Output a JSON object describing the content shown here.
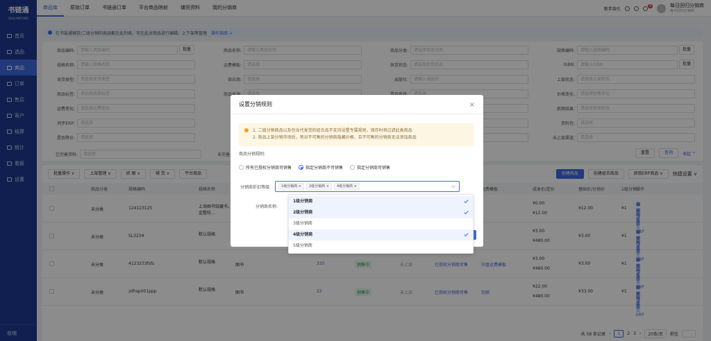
{
  "sidebar": {
    "logo": "书链通",
    "logo_sub": "SHULIANTONG",
    "items": [
      {
        "label": "首页"
      },
      {
        "label": "选品"
      },
      {
        "label": "商品"
      },
      {
        "label": "订单"
      },
      {
        "label": "售后"
      },
      {
        "label": "客户"
      },
      {
        "label": "结算"
      },
      {
        "label": "统计"
      },
      {
        "label": "看板"
      },
      {
        "label": "设置"
      }
    ],
    "bottom": "收缩"
  },
  "topbar": {
    "tabs": [
      "商品库",
      "原始订单",
      "书链通订单",
      "平台商品映射",
      "铺货资料",
      "我的分销商"
    ],
    "guide": "新手指引",
    "badge": "9",
    "user_name": "每日回归分销商",
    "user_sub": "每日回归分销商"
  },
  "notice": {
    "text": "在书链通铺货/二级分销的商品都在此列表，可在此对商品进行编辑、上下架等管理",
    "link": "操作指南 >"
  },
  "filters": {
    "rows": [
      [
        {
          "label": "商品编码:",
          "ph": "请输入商品编码",
          "btn": "批量"
        },
        {
          "label": "商品名称:",
          "ph": "请输入商品名称"
        },
        {
          "label": "商品分类:",
          "ph": "请选择商品分类"
        },
        {
          "label": "规格编码:",
          "ph": "请输入规格编码",
          "btn": "批量"
        }
      ],
      [
        {
          "label": "规格名称:",
          "ph": "请输入规格名称"
        },
        {
          "label": "运费模板:",
          "ph": "请选择"
        },
        {
          "label": "供货状态:",
          "ph": "请选择供货状态"
        },
        {
          "label": "ISBN:",
          "ph": "请输入ISBN",
          "btn": "批量"
        }
      ],
      [
        {
          "label": "发货类型:",
          "ph": "请选择发货类型"
        },
        {
          "label": "供应商:",
          "ph": "请选择"
        },
        {
          "label": "出版社:",
          "ph": "请输入出版社"
        },
        {
          "label": "上架状态:",
          "ph": "请选择上架状态"
        }
      ],
      [
        {
          "label": "商品标签:",
          "ph": "请选择商品标签"
        },
        {
          "label": "商品来源:",
          "ph": "请选择"
        },
        {
          "label": "是否有效:",
          "ph": "请选择"
        },
        {
          "label": "价格变化:",
          "ph": "请选择价格变化"
        }
      ],
      [
        {
          "label": "运费变化:",
          "ph": "请选择运费变化"
        },
        {
          "label": "更新:",
          "ph": "请选择"
        },
        {
          "label": "上架渠道:",
          "ph": "请选择"
        },
        {
          "label": "抓图结果:",
          "ph": "请选择抓图状态"
        }
      ],
      [
        {
          "label": "同步ERP:",
          "ph": "请选择"
        },
        {
          "label": "有无:",
          "ph": "请选择"
        },
        {
          "label": "库存:",
          "ph": "请选择"
        },
        {
          "label": "资料包:",
          "ph": "请选择"
        }
      ],
      [
        {
          "label": "是否降价:",
          "ph": "请选择"
        },
        {
          "label": "禁售:",
          "ph": "请选择"
        },
        {
          "label": "平台:",
          "ph": "请选择"
        },
        {
          "label": "未上架渠道:",
          "ph": "请选择"
        }
      ]
    ],
    "complete_label": "已完善资料:",
    "complete_ph": "请选择",
    "complete2_label": "未完善资",
    "reset": "重置",
    "query": "查询",
    "collapse": "收起 ^"
  },
  "toolbar": {
    "buttons": [
      "批量操作 ∨",
      "上架管理 ∨",
      "抓 图 ∨",
      "铺 货 ∨",
      "平台商品"
    ],
    "create": "创建商品",
    "create_combo": "创建组合商品",
    "erp": "抓取ERP商品 ∨",
    "quick": "快捷设置 ∨"
  },
  "table": {
    "headers": [
      "商品分类",
      "规格编码",
      "规格名称",
      "运费模板",
      "成本价/定价",
      "基础价/分销价",
      "1级分销",
      "操作"
    ],
    "rows": [
      {
        "cat": "未分类",
        "code": "124123125",
        "name": "上海图书馆藏书，本套资金整较...",
        "price1": "¥0.00",
        "price2": "¥12.00",
        "base": "¥12.00",
        "lvl": "¥1"
      },
      {
        "cat": "未分类",
        "code": "SL3234",
        "name": "默认规格",
        "type": "图书",
        "price1": "¥3.00",
        "price2": "¥480.00",
        "base": "¥3.00",
        "lvl": "¥1"
      },
      {
        "cat": "未分类",
        "code": "4123233fsfs",
        "name": "默认规格",
        "type": "图书",
        "stock": "335",
        "status": "销售中",
        "shelf": "未上架",
        "dist": "已授权分销商可售",
        "tpl": "中盘运费模板",
        "price1": "¥3.00",
        "price2": "¥480.00",
        "base": "¥3.00",
        "lvl": "¥1"
      },
      {
        "cat": "未分类",
        "code": "zdhsp001ppp",
        "name": "默认规格",
        "type": "图书",
        "stock": "22",
        "status": "销售中",
        "shelf": "未上架",
        "dist": "已授权分销商可售",
        "tpl": "包邮",
        "price1": "¥22.00",
        "price2": "¥480.00",
        "base": "¥33.00",
        "lvl": "¥1"
      }
    ],
    "ops": [
      "编辑",
      "分销详情",
      "操作日志",
      "同步至ERP",
      "更多"
    ]
  },
  "pager": {
    "total": "共 58 条记录",
    "pages": [
      "1",
      "2",
      "3"
    ],
    "size": "20条/页",
    "goto": "前往"
  },
  "modal": {
    "title": "设置分销规则",
    "warn1": "1. 二级分销商品以及包含代发货的组合品不支持设置专属规则，保存时将过滤此类商品",
    "warn2": "2. 商品上架分销市场后，将对不可售的分销商隐藏价格，且不可售的分销商无法添加商品",
    "rule_label": "商品分销规则:",
    "radios": [
      "所有已授权分销商可销售",
      "指定分销商不可销售",
      "指定分销商可销售"
    ],
    "level_label": "分销商折扣等级:",
    "tags": [
      "1级分销商",
      "2级分销商",
      "4级分销商"
    ],
    "name_label": "分销商名称:",
    "options": [
      {
        "label": "1级分销商",
        "selected": true
      },
      {
        "label": "2级分销商",
        "selected": true
      },
      {
        "label": "3级分销商",
        "selected": false
      },
      {
        "label": "4级分销商",
        "selected": true
      },
      {
        "label": "5级分销商",
        "selected": false
      }
    ]
  },
  "colors": {
    "primary": "#3d6be0",
    "sidebar": "#1f3a93"
  }
}
